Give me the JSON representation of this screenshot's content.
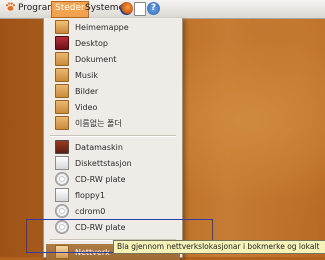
{
  "panel": {
    "menus": [
      "Program",
      "Steder",
      "Systemet"
    ],
    "active_menu": "Steder"
  },
  "places_menu": {
    "bookmarks": [
      "Heimemappe",
      "Desktop",
      "Dokument",
      "Musik",
      "Bilder",
      "Video",
      "이름없는 폴더"
    ],
    "devices": [
      "Datamaskin",
      "Diskettstasjon",
      "CD-RW plate",
      "floppy1",
      "cdrom0",
      "CD-RW plate"
    ],
    "network": "Nettverk",
    "highlighted_item": "Nettverk"
  },
  "tooltip": {
    "text": "Bla gjennom nettverkslokasjonar i bokmerke og lokalt"
  },
  "colors": {
    "panel_active": "#f2a350",
    "menu_highlight": "#a8733d",
    "selection_box": "#2c3ea8",
    "tooltip_bg": "#f5f3b8"
  }
}
